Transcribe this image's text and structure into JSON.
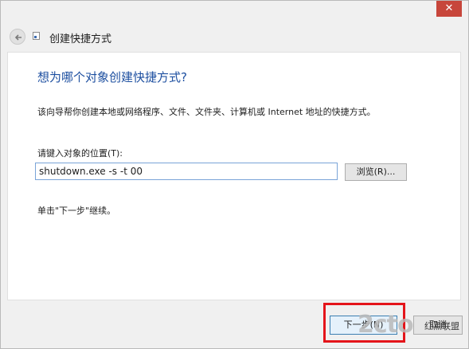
{
  "window": {
    "close_symbol": "✕"
  },
  "header": {
    "title": "创建快捷方式",
    "back_icon": "back-arrow-icon",
    "wizard_icon": "shortcut-wizard-icon"
  },
  "main": {
    "heading": "想为哪个对象创建快捷方式?",
    "description": "该向导帮你创建本地或网络程序、文件、文件夹、计算机或 Internet 地址的快捷方式。",
    "location_label": "请键入对象的位置(T):",
    "location_value": "shutdown.exe -s -t 00",
    "browse_label": "浏览(R)...",
    "hint": "单击\"下一步\"继续。"
  },
  "footer": {
    "next_label": "下一步(N)",
    "cancel_label": "取消"
  },
  "watermark": {
    "logo": "2cto",
    "sub": "红黑联盟"
  },
  "colors": {
    "heading": "#1d4fa0",
    "highlight": "#e4141a",
    "close": "#c7463b"
  }
}
